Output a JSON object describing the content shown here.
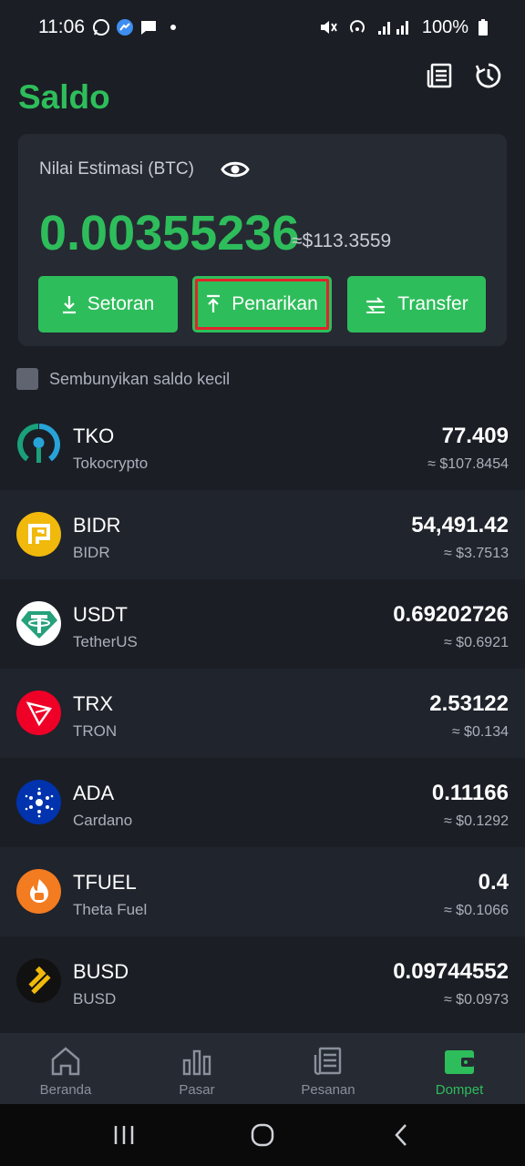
{
  "status_bar": {
    "time": "11:06",
    "battery": "100%"
  },
  "header": {
    "title": "Saldo"
  },
  "balance": {
    "label": "Nilai Estimasi (BTC)",
    "btc_value": "0.00355236",
    "usd_value": "≈$113.3559",
    "buttons": {
      "deposit": "Setoran",
      "withdraw": "Penarikan",
      "transfer": "Transfer"
    }
  },
  "hide_small": {
    "label": "Sembunyikan saldo kecil",
    "checked": false
  },
  "assets": [
    {
      "symbol": "TKO",
      "name": "Tokocrypto",
      "amount": "77.409",
      "fiat": "≈ $107.8454",
      "color": "#1aa07b"
    },
    {
      "symbol": "BIDR",
      "name": "BIDR",
      "amount": "54,491.42",
      "fiat": "≈ $3.7513",
      "color": "#f0b90b"
    },
    {
      "symbol": "USDT",
      "name": "TetherUS",
      "amount": "0.69202726",
      "fiat": "≈ $0.6921",
      "color": "#26a17b"
    },
    {
      "symbol": "TRX",
      "name": "TRON",
      "amount": "2.53122",
      "fiat": "≈ $0.134",
      "color": "#ef0027"
    },
    {
      "symbol": "ADA",
      "name": "Cardano",
      "amount": "0.11166",
      "fiat": "≈ $0.1292",
      "color": "#0033ad"
    },
    {
      "symbol": "TFUEL",
      "name": "Theta Fuel",
      "amount": "0.4",
      "fiat": "≈ $0.1066",
      "color": "#f37b20"
    },
    {
      "symbol": "BUSD",
      "name": "BUSD",
      "amount": "0.09744552",
      "fiat": "≈ $0.0973",
      "color": "#111111"
    }
  ],
  "bottom_nav": {
    "home": "Beranda",
    "market": "Pasar",
    "orders": "Pesanan",
    "wallet": "Dompet",
    "active": "wallet",
    "active_color": "#2ebd5b"
  }
}
